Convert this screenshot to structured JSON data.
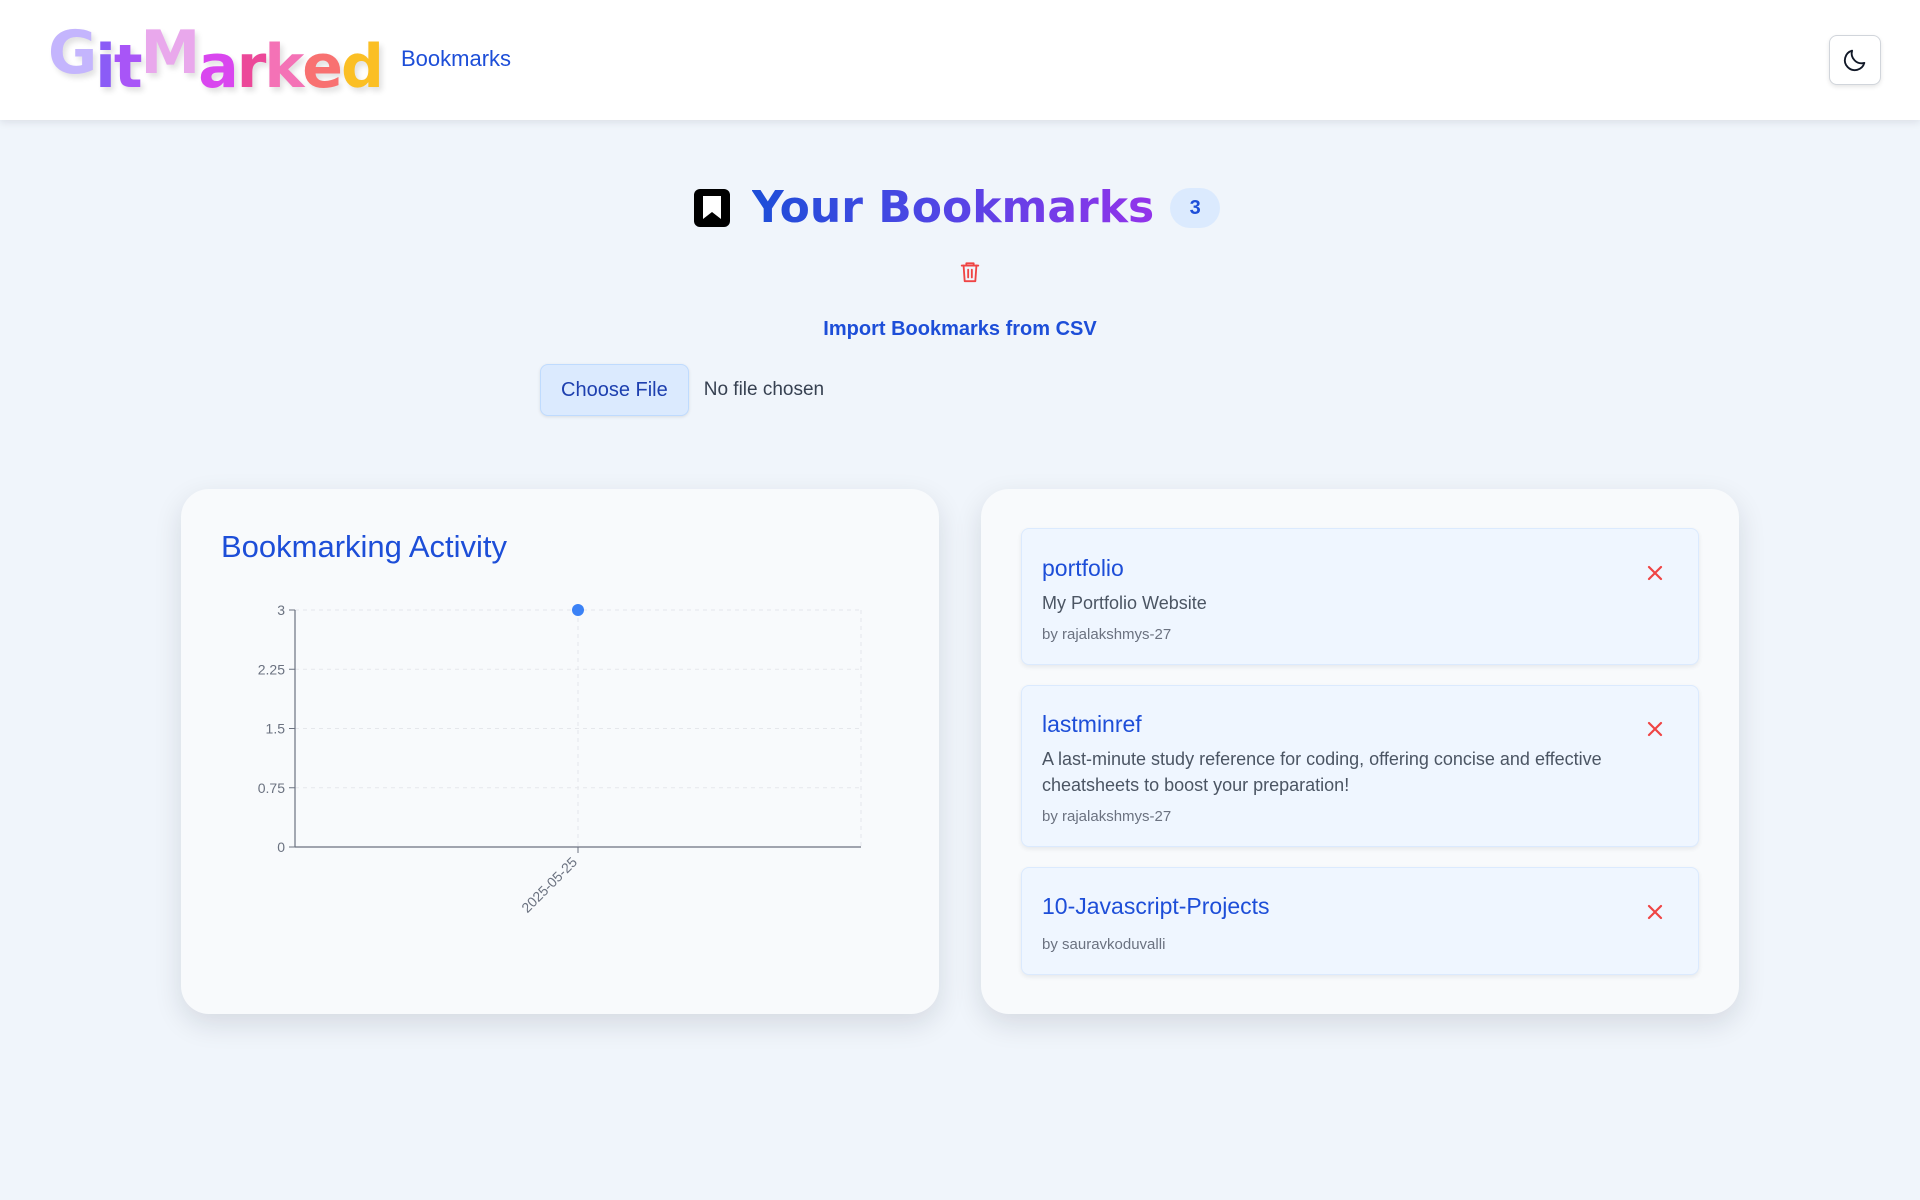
{
  "app": {
    "logo_letters": [
      "G",
      "i",
      "t",
      "M",
      "a",
      "r",
      "k",
      "e",
      "d"
    ]
  },
  "nav": {
    "bookmarks_label": "Bookmarks"
  },
  "icons": {
    "theme": "moon-icon",
    "title": "bookmark-icon",
    "clear_all": "trash-icon",
    "remove": "close-icon"
  },
  "page": {
    "title": "Your Bookmarks",
    "count": "3",
    "import_label": "Import Bookmarks from CSV",
    "file_button": "Choose File",
    "file_status": "No file chosen"
  },
  "activity": {
    "title": "Bookmarking Activity"
  },
  "chart_data": {
    "type": "line",
    "title": "Bookmarking Activity",
    "xlabel": "",
    "ylabel": "",
    "x": [
      "2025-05-25"
    ],
    "series": [
      {
        "values": [
          3
        ]
      }
    ],
    "ylim": [
      0,
      3
    ],
    "yticks": [
      "0",
      "0.75",
      "1.5",
      "2.25",
      "3"
    ],
    "grid": true,
    "legend": "none"
  },
  "bookmarks": [
    {
      "name": "portfolio",
      "description": "My Portfolio Website",
      "author": "by rajalakshmys-27"
    },
    {
      "name": "lastminref",
      "description": "A last-minute study reference for coding, offering concise and effective cheatsheets to boost your preparation!",
      "author": "by rajalakshmys-27"
    },
    {
      "name": "10-Javascript-Projects",
      "description": "",
      "author": "by sauravkoduvalli"
    }
  ],
  "colors": {
    "accent": "#1d4ed8",
    "danger": "#ef4444",
    "point": "#3b82f6",
    "badge_bg": "#dbeafe",
    "page_bg": "#f0f5fb"
  }
}
